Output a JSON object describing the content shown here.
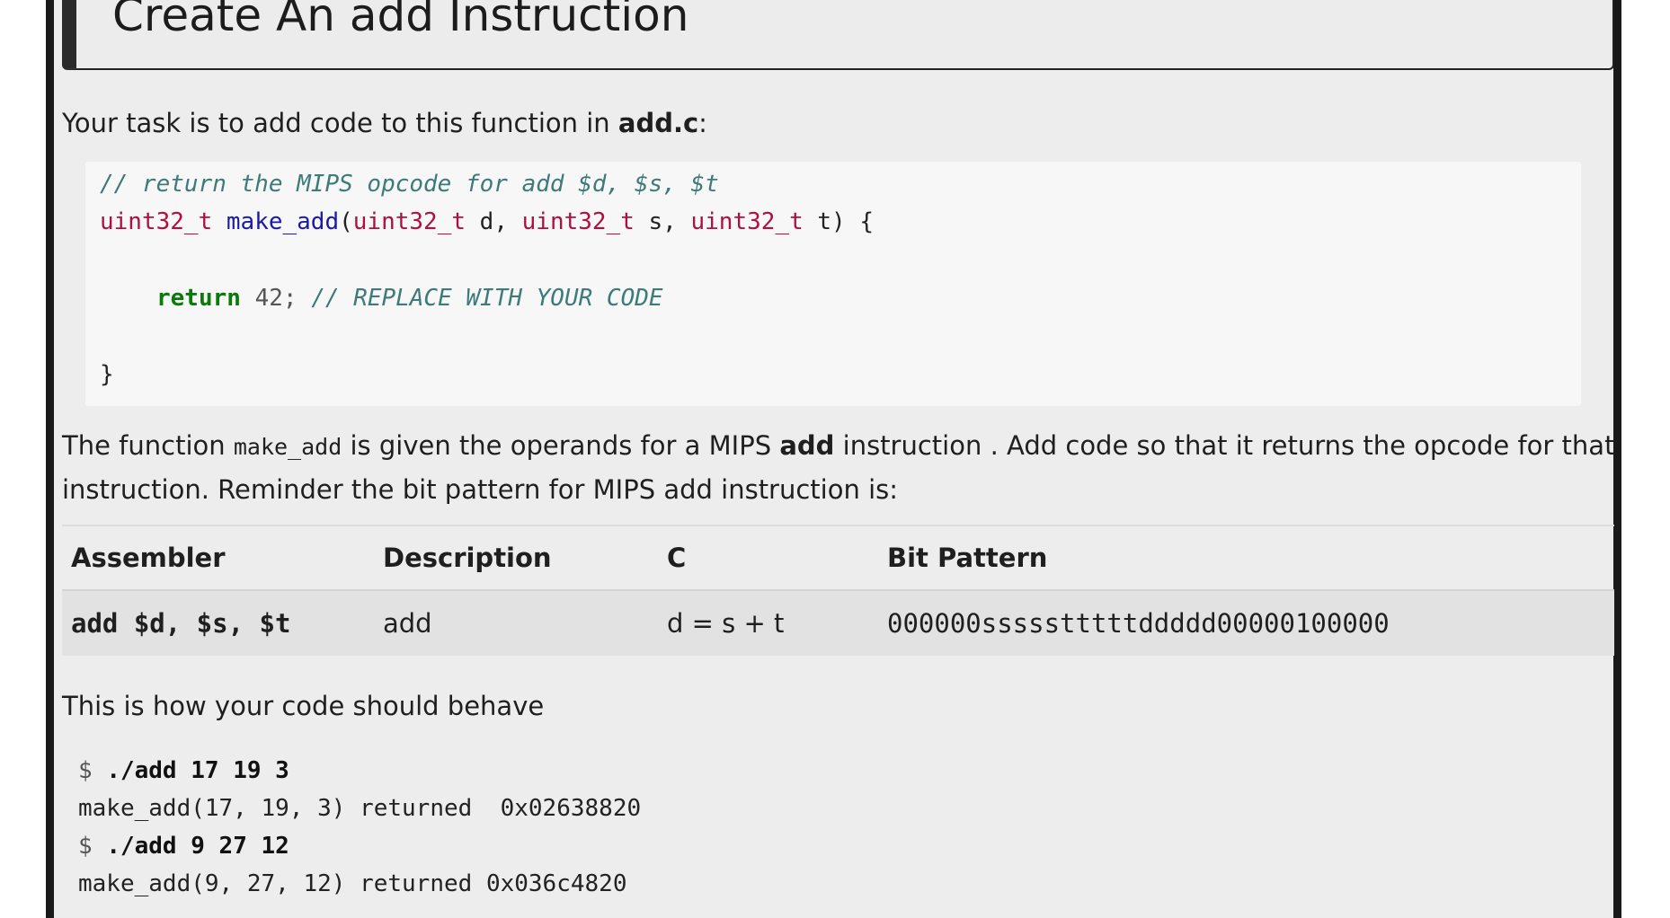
{
  "title": "Create An add Instruction",
  "intro": {
    "prefix": "Your task is to add code to this function in ",
    "file": "add.c",
    "suffix": ":"
  },
  "code": {
    "comment1": "// return the MIPS opcode for add $d, $s, $t",
    "sig_type1": "uint32_t",
    "sig_fn": "make_add",
    "sig_open": "(",
    "sig_type2": "uint32_t",
    "sig_p1": " d, ",
    "sig_type3": "uint32_t",
    "sig_p2": " s, ",
    "sig_type4": "uint32_t",
    "sig_p3": " t) {",
    "ret_kw": "return",
    "ret_val": " 42; ",
    "ret_comment": "// REPLACE WITH YOUR CODE",
    "close": "}"
  },
  "description": {
    "p1": "The function ",
    "fn": "make_add",
    "p2": " is given the operands for a MIPS ",
    "bold": "add",
    "p3": " instruction . Add code so that it returns the opcode for that",
    "line2": "instruction. Reminder the bit pattern for MIPS add instruction is:"
  },
  "table": {
    "headers": [
      "Assembler",
      "Description",
      "C",
      "Bit Pattern"
    ],
    "row": {
      "assembler": "add $d, $s, $t",
      "description": "add",
      "c": "d = s + t",
      "bit_pattern": "000000ssssstttttddddd00000100000"
    }
  },
  "behave_text": "This is how your code should behave",
  "terminal": [
    {
      "prompt": "$ ",
      "cmd": "./add 17 19 3"
    },
    {
      "output": "make_add(17, 19, 3) returned  0x02638820"
    },
    {
      "prompt": "$ ",
      "cmd": "./add 9 27 12"
    },
    {
      "output": "make_add(9, 27, 12) returned 0x036c4820"
    }
  ]
}
